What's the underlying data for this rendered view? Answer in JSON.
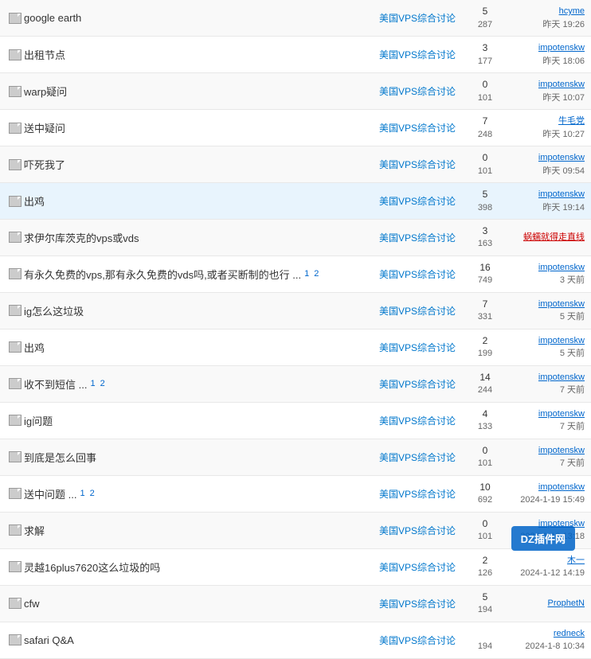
{
  "threads": [
    {
      "id": 1,
      "title": "google earth",
      "pages": [],
      "forum": "美国VPS综合讨论",
      "replies": "5",
      "views": "287",
      "author": "hcyme",
      "author_class": "",
      "time": "昨天 19:26",
      "highlight": false
    },
    {
      "id": 2,
      "title": "出租节点",
      "pages": [],
      "forum": "美国VPS综合讨论",
      "replies": "3",
      "views": "177",
      "author": "impotenskw",
      "author_class": "",
      "time": "昨天 18:06",
      "highlight": false
    },
    {
      "id": 3,
      "title": "warp疑问",
      "pages": [],
      "forum": "美国VPS综合讨论",
      "replies": "0",
      "views": "101",
      "author": "impotenskw",
      "author_class": "",
      "time": "昨天 10:07",
      "highlight": false
    },
    {
      "id": 4,
      "title": "送中疑问",
      "pages": [],
      "forum": "美国VPS综合讨论",
      "replies": "7",
      "views": "248",
      "author": "牛毛党",
      "author_class": "",
      "time": "昨天 10:27",
      "highlight": false
    },
    {
      "id": 5,
      "title": "吓死我了",
      "pages": [],
      "forum": "美国VPS综合讨论",
      "replies": "0",
      "views": "101",
      "author": "impotenskw",
      "author_class": "",
      "time": "昨天 09:54",
      "highlight": false
    },
    {
      "id": 6,
      "title": "出鸡",
      "pages": [],
      "forum": "美国VPS综合讨论",
      "replies": "5",
      "views": "398",
      "author": "impotenskw",
      "author_class": "",
      "time": "昨天 19:14",
      "highlight": true
    },
    {
      "id": 7,
      "title": "求伊尔库茨克的vps或vds",
      "pages": [],
      "forum": "美国VPS综合讨论",
      "replies": "3",
      "views": "163",
      "author": "蜗蠕就得走直线",
      "author_class": "red",
      "time": "",
      "highlight": false
    },
    {
      "id": 8,
      "title": "有永久免费的vps,那有永久免费的vds吗,或者买断制的也行 ...",
      "pages": [
        "1",
        "2"
      ],
      "forum": "美国VPS综合讨论",
      "replies": "16",
      "views": "749",
      "author": "impotenskw",
      "author_class": "",
      "time": "3 天前",
      "highlight": false
    },
    {
      "id": 9,
      "title": "ig怎么这垃圾",
      "pages": [],
      "forum": "美国VPS综合讨论",
      "replies": "7",
      "views": "331",
      "author": "impotenskw",
      "author_class": "",
      "time": "5 天前",
      "highlight": false
    },
    {
      "id": 10,
      "title": "出鸡",
      "pages": [],
      "forum": "美国VPS综合讨论",
      "replies": "2",
      "views": "199",
      "author": "impotenskw",
      "author_class": "",
      "time": "5 天前",
      "highlight": false
    },
    {
      "id": 11,
      "title": "收不到短信 ...",
      "pages": [
        "1",
        "2"
      ],
      "forum": "美国VPS综合讨论",
      "replies": "14",
      "views": "244",
      "author": "impotenskw",
      "author_class": "",
      "time": "7 天前",
      "highlight": false
    },
    {
      "id": 12,
      "title": "ig问题",
      "pages": [],
      "forum": "美国VPS综合讨论",
      "replies": "4",
      "views": "133",
      "author": "impotenskw",
      "author_class": "",
      "time": "7 天前",
      "highlight": false
    },
    {
      "id": 13,
      "title": "到底是怎么回事",
      "pages": [],
      "forum": "美国VPS综合讨论",
      "replies": "0",
      "views": "101",
      "author": "impotenskw",
      "author_class": "",
      "time": "7 天前",
      "highlight": false
    },
    {
      "id": 14,
      "title": "送中问题 ...",
      "pages": [
        "1",
        "2"
      ],
      "forum": "美国VPS综合讨论",
      "replies": "10",
      "views": "692",
      "author": "impotenskw",
      "author_class": "",
      "time": "2024-1-19 15:49",
      "highlight": false
    },
    {
      "id": 15,
      "title": "求解",
      "pages": [],
      "forum": "美国VPS综合讨论",
      "replies": "0",
      "views": "101",
      "author": "impotenskw",
      "author_class": "",
      "time": "2024-1-13 13:18",
      "highlight": false
    },
    {
      "id": 16,
      "title": "灵越16plus7620这么垃圾的吗",
      "pages": [],
      "forum": "美国VPS综合讨论",
      "replies": "2",
      "views": "126",
      "author": "木一",
      "author_class": "",
      "time": "2024-1-12 14:19",
      "highlight": false
    },
    {
      "id": 17,
      "title": "cfw",
      "pages": [],
      "forum": "美国VPS综合讨论",
      "replies": "5",
      "views": "194",
      "author": "ProphetN",
      "author_class": "",
      "time": "",
      "highlight": false
    },
    {
      "id": 18,
      "title": "safari Q&A",
      "pages": [],
      "forum": "美国VPS综合讨论",
      "replies": "",
      "views": "194",
      "author": "redneck",
      "author_class": "",
      "time": "2024-1-8 10:34",
      "highlight": false
    }
  ],
  "watermark": "DZ插件网"
}
